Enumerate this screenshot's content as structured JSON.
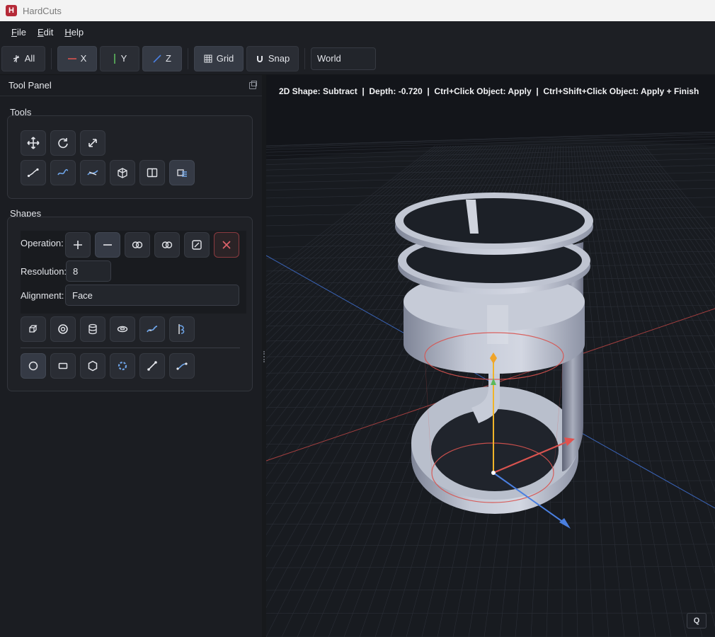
{
  "app": {
    "title": "HardCuts",
    "icon_letter": "H"
  },
  "menu": [
    {
      "label": "File",
      "accel": "F",
      "rest": "ile"
    },
    {
      "label": "Edit",
      "accel": "E",
      "rest": "dit"
    },
    {
      "label": "Help",
      "accel": "H",
      "rest": "elp"
    }
  ],
  "toolbar": {
    "all_label": "All",
    "x_label": "X",
    "y_label": "Y",
    "z_label": "Z",
    "grid_label": "Grid",
    "snap_label": "Snap",
    "space_value": "World"
  },
  "tool_panel": {
    "title": "Tool Panel",
    "tools_title": "Tools",
    "shapes_title": "Shapes",
    "operation_label": "Operation:",
    "resolution_label": "Resolution:",
    "resolution_value": "8",
    "alignment_label": "Alignment:",
    "alignment_value": "Face"
  },
  "viewport": {
    "hud": "2D Shape: Subtract  |  Depth: -0.720  |  Ctrl+Click Object: Apply  |  Ctrl+Shift+Click Object: Apply + Finish",
    "q_label": "Q"
  },
  "colors": {
    "axis_x": "#d9534f",
    "axis_y": "#5cb85c",
    "axis_z": "#4a7fe0",
    "gizmo_y": "#f0b429",
    "accent": "#4a90d9"
  }
}
